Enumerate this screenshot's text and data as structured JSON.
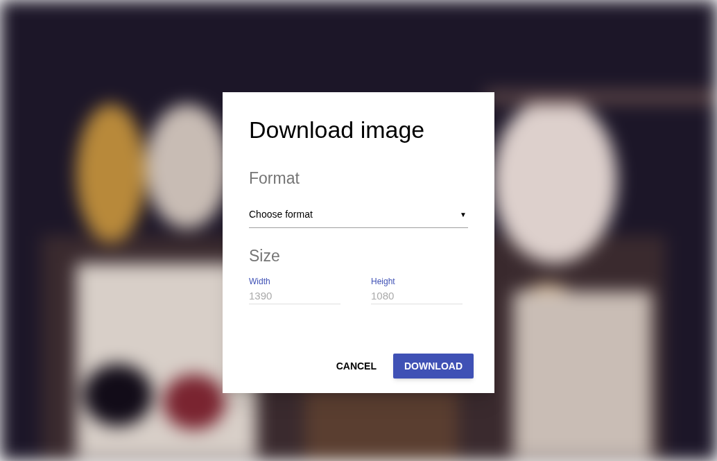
{
  "dialog": {
    "title": "Download image",
    "format": {
      "heading": "Format",
      "select_text": "Choose format",
      "arrow": "▼"
    },
    "size": {
      "heading": "Size",
      "fields": [
        {
          "label": "Width",
          "placeholder": "1390"
        },
        {
          "label": "Height",
          "placeholder": "1080"
        }
      ]
    },
    "buttons": [
      {
        "label": "CANCEL",
        "kind": "flat"
      },
      {
        "label": "DOWNLOAD",
        "kind": "raised"
      }
    ]
  }
}
